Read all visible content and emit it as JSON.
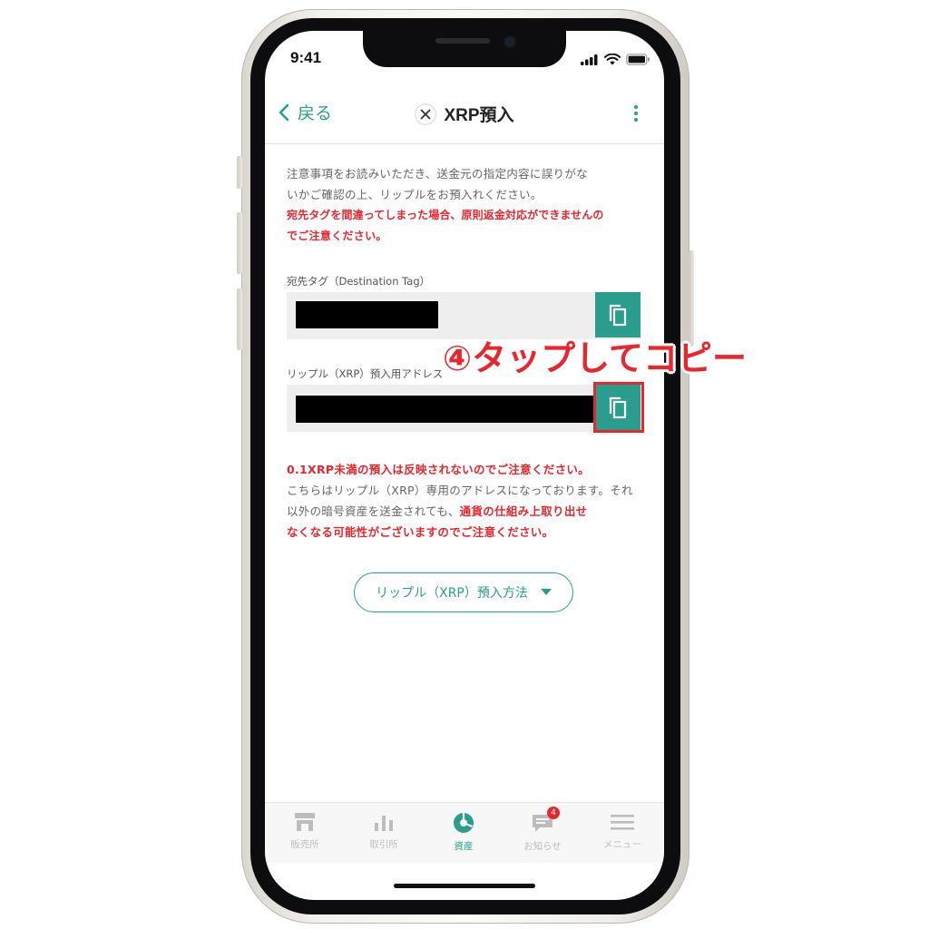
{
  "status_bar": {
    "time": "9:41"
  },
  "nav": {
    "back_label": "戻る",
    "title": "XRP預入"
  },
  "notice": {
    "line1": "注意事項をお読みいただき、送金元の指定内容に誤りがな",
    "line2": "いかご確認の上、リップルをお預入れください。",
    "warn_line1": "宛先タグを間違ってしまった場合、原則返金対応ができませんの",
    "warn_line2": "でご注意ください。"
  },
  "fields": {
    "destination_tag_label": "宛先タグ（Destination Tag）",
    "address_label": "リップル（XRP）預入用アドレス"
  },
  "warning": {
    "min_amount": "0.1XRP未満の預入は反映されないのでご注意ください。",
    "grey_line1": "こちらはリップル（XRP）専用のアドレスになっております。それ",
    "grey_line2": "以外の暗号資産を送金されても、",
    "red_tail": "通貨の仕組み上取り出せ",
    "red_line3": "なくなる可能性がございますのでご注意ください。"
  },
  "method_button": {
    "label": "リップル（XRP）預入方法"
  },
  "tabbar": {
    "items": [
      {
        "label": "販売所",
        "icon": "shop-icon",
        "active": false
      },
      {
        "label": "取引所",
        "icon": "bar-chart-icon",
        "active": false
      },
      {
        "label": "資産",
        "icon": "pie-chart-icon",
        "active": true
      },
      {
        "label": "お知らせ",
        "icon": "message-icon",
        "active": false,
        "badge": "4"
      },
      {
        "label": "メニュー",
        "icon": "hamburger-menu-icon",
        "active": false
      }
    ]
  },
  "annotation": {
    "text": "④タップしてコピー"
  },
  "colors": {
    "accent": "#2a9d8f",
    "warning": "#e8262d",
    "inactive": "#bdbdbd"
  }
}
